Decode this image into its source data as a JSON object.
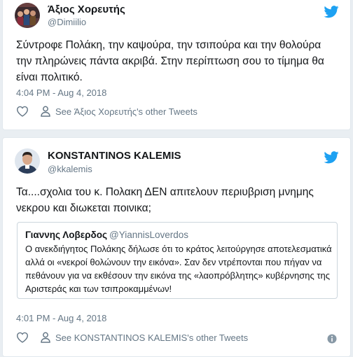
{
  "tweets": [
    {
      "name": "Άξιος Χορευτής",
      "handle": "@Dimiilio",
      "text": "Σύντροφε Πολάκη, την καψούρα, την τσιπούρα και την θολούρα την πληρώνεις πάντα ακριβά. Στην περίπτωση σου το τίμημα θα είναι πολιτικό.",
      "timestamp": "4:04 PM - Aug 4, 2018",
      "other_tweets": "See Άξιος Χορευτής's other Tweets"
    },
    {
      "name": "KONSTANTINOS KALEMIS",
      "handle": "@kkalemis",
      "text": "Τα....σχολια του κ. Πολακη ΔΕΝ απιτελουν περιυβριση μνημης νεκρου και διωκεται ποινικα;",
      "quote": {
        "name": "Γιαννης Λοβερδος",
        "handle": "@YiannisLoverdos",
        "text": "Ο ανεκδιήγητος Πολάκης δήλωσε ότι το κράτος λειτούργησε αποτελεσματικά αλλά οι «νεκροί θολώνουν την εικόνα». Σαν δεν ντρέπονται που πήγαν να πεθάνουν για να εκθέσουν την εικόνα της «λαοπρόβλητης» κυβέρνησης της Αριστεράς και των τσιπροκαμμένων!"
      },
      "timestamp": "4:01 PM - Aug 4, 2018",
      "other_tweets": "See KONSTANTINOS KALEMIS's other Tweets"
    }
  ],
  "colors": {
    "twitter_blue": "#1da1f2",
    "secondary_text": "#657786",
    "border": "#e1e8ed"
  },
  "icons": {
    "brand": "twitter-bird-icon",
    "like": "heart-icon",
    "profile": "person-icon",
    "info": "info-icon"
  }
}
